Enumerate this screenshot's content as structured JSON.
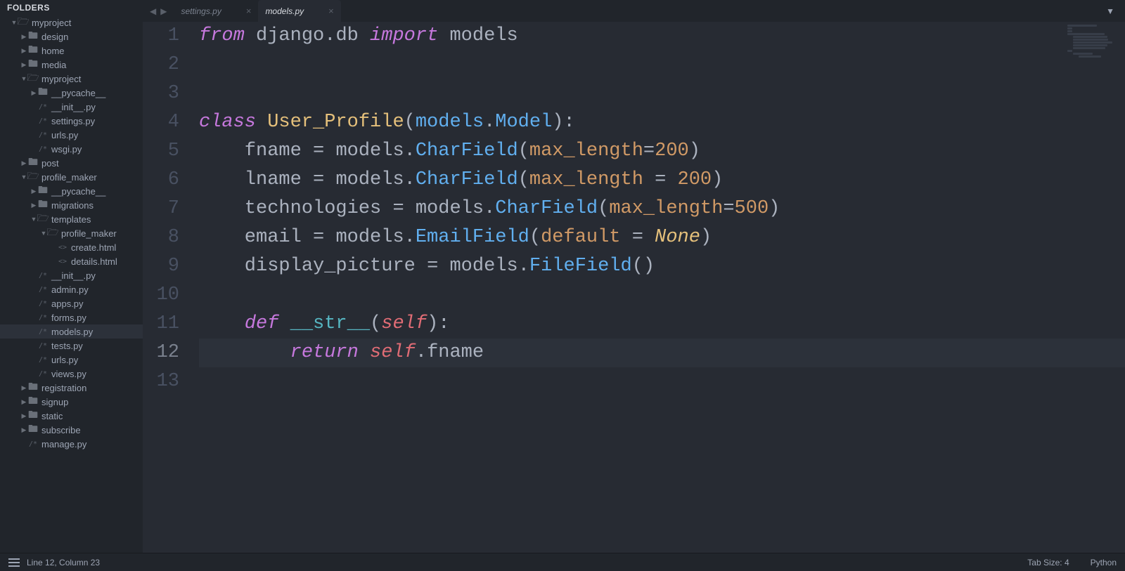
{
  "sidebar": {
    "header": "FOLDERS",
    "tree": [
      {
        "depth": 0,
        "arrow": "▼",
        "icon": "folder-open",
        "label": "myproject"
      },
      {
        "depth": 1,
        "arrow": "▶",
        "icon": "folder",
        "label": "design"
      },
      {
        "depth": 1,
        "arrow": "▶",
        "icon": "folder",
        "label": "home"
      },
      {
        "depth": 1,
        "arrow": "▶",
        "icon": "folder",
        "label": "media"
      },
      {
        "depth": 1,
        "arrow": "▼",
        "icon": "folder-open",
        "label": "myproject"
      },
      {
        "depth": 2,
        "arrow": "▶",
        "icon": "folder",
        "label": "__pycache__"
      },
      {
        "depth": 2,
        "arrow": "",
        "icon": "py",
        "label": "__init__.py"
      },
      {
        "depth": 2,
        "arrow": "",
        "icon": "py",
        "label": "settings.py"
      },
      {
        "depth": 2,
        "arrow": "",
        "icon": "py",
        "label": "urls.py"
      },
      {
        "depth": 2,
        "arrow": "",
        "icon": "py",
        "label": "wsgi.py"
      },
      {
        "depth": 1,
        "arrow": "▶",
        "icon": "folder",
        "label": "post"
      },
      {
        "depth": 1,
        "arrow": "▼",
        "icon": "folder-open",
        "label": "profile_maker"
      },
      {
        "depth": 2,
        "arrow": "▶",
        "icon": "folder",
        "label": "__pycache__"
      },
      {
        "depth": 2,
        "arrow": "▶",
        "icon": "folder",
        "label": "migrations"
      },
      {
        "depth": 2,
        "arrow": "▼",
        "icon": "folder-open",
        "label": "templates"
      },
      {
        "depth": 3,
        "arrow": "▼",
        "icon": "folder-open",
        "label": "profile_maker"
      },
      {
        "depth": 4,
        "arrow": "",
        "icon": "html",
        "label": "create.html"
      },
      {
        "depth": 4,
        "arrow": "",
        "icon": "html",
        "label": "details.html"
      },
      {
        "depth": 2,
        "arrow": "",
        "icon": "py",
        "label": "__init__.py"
      },
      {
        "depth": 2,
        "arrow": "",
        "icon": "py",
        "label": "admin.py"
      },
      {
        "depth": 2,
        "arrow": "",
        "icon": "py",
        "label": "apps.py"
      },
      {
        "depth": 2,
        "arrow": "",
        "icon": "py",
        "label": "forms.py"
      },
      {
        "depth": 2,
        "arrow": "",
        "icon": "py",
        "label": "models.py",
        "selected": true
      },
      {
        "depth": 2,
        "arrow": "",
        "icon": "py",
        "label": "tests.py"
      },
      {
        "depth": 2,
        "arrow": "",
        "icon": "py",
        "label": "urls.py"
      },
      {
        "depth": 2,
        "arrow": "",
        "icon": "py",
        "label": "views.py"
      },
      {
        "depth": 1,
        "arrow": "▶",
        "icon": "folder",
        "label": "registration"
      },
      {
        "depth": 1,
        "arrow": "▶",
        "icon": "folder",
        "label": "signup"
      },
      {
        "depth": 1,
        "arrow": "▶",
        "icon": "folder",
        "label": "static"
      },
      {
        "depth": 1,
        "arrow": "▶",
        "icon": "folder",
        "label": "subscribe"
      },
      {
        "depth": 1,
        "arrow": "",
        "icon": "py",
        "label": "manage.py"
      }
    ]
  },
  "tabs": [
    {
      "label": "settings.py",
      "active": false
    },
    {
      "label": "models.py",
      "active": true
    }
  ],
  "code": {
    "active_line": 12,
    "lines": [
      [
        {
          "c": "kw-from",
          "t": "from"
        },
        {
          "c": "pale",
          "t": " django"
        },
        {
          "c": "punct",
          "t": "."
        },
        {
          "c": "pale",
          "t": "db "
        },
        {
          "c": "kw-import",
          "t": "import"
        },
        {
          "c": "pale",
          "t": " models"
        }
      ],
      [],
      [],
      [
        {
          "c": "kw-class",
          "t": "class"
        },
        {
          "c": "pale",
          "t": " "
        },
        {
          "c": "fn",
          "t": "User_Profile"
        },
        {
          "c": "punct",
          "t": "("
        },
        {
          "c": "cls",
          "t": "models"
        },
        {
          "c": "punct",
          "t": "."
        },
        {
          "c": "cls",
          "t": "Model"
        },
        {
          "c": "punct",
          "t": "):"
        }
      ],
      [
        {
          "c": "pale",
          "t": "    fname "
        },
        {
          "c": "punct",
          "t": "= "
        },
        {
          "c": "pale",
          "t": "models"
        },
        {
          "c": "punct",
          "t": "."
        },
        {
          "c": "cls",
          "t": "CharField"
        },
        {
          "c": "punct",
          "t": "("
        },
        {
          "c": "param",
          "t": "max_length"
        },
        {
          "c": "punct",
          "t": "="
        },
        {
          "c": "num",
          "t": "200"
        },
        {
          "c": "punct",
          "t": ")"
        }
      ],
      [
        {
          "c": "pale",
          "t": "    lname "
        },
        {
          "c": "punct",
          "t": "= "
        },
        {
          "c": "pale",
          "t": "models"
        },
        {
          "c": "punct",
          "t": "."
        },
        {
          "c": "cls",
          "t": "CharField"
        },
        {
          "c": "punct",
          "t": "("
        },
        {
          "c": "param",
          "t": "max_length"
        },
        {
          "c": "punct",
          "t": " = "
        },
        {
          "c": "num",
          "t": "200"
        },
        {
          "c": "punct",
          "t": ")"
        }
      ],
      [
        {
          "c": "pale",
          "t": "    technologies "
        },
        {
          "c": "punct",
          "t": "= "
        },
        {
          "c": "pale",
          "t": "models"
        },
        {
          "c": "punct",
          "t": "."
        },
        {
          "c": "cls",
          "t": "CharField"
        },
        {
          "c": "punct",
          "t": "("
        },
        {
          "c": "param",
          "t": "max_length"
        },
        {
          "c": "punct",
          "t": "="
        },
        {
          "c": "num",
          "t": "500"
        },
        {
          "c": "punct",
          "t": ")"
        }
      ],
      [
        {
          "c": "pale",
          "t": "    email "
        },
        {
          "c": "punct",
          "t": "= "
        },
        {
          "c": "pale",
          "t": "models"
        },
        {
          "c": "punct",
          "t": "."
        },
        {
          "c": "cls",
          "t": "EmailField"
        },
        {
          "c": "punct",
          "t": "("
        },
        {
          "c": "param",
          "t": "default"
        },
        {
          "c": "punct",
          "t": " = "
        },
        {
          "c": "none",
          "t": "None"
        },
        {
          "c": "punct",
          "t": ")"
        }
      ],
      [
        {
          "c": "pale",
          "t": "    display_picture "
        },
        {
          "c": "punct",
          "t": "= "
        },
        {
          "c": "pale",
          "t": "models"
        },
        {
          "c": "punct",
          "t": "."
        },
        {
          "c": "cls",
          "t": "FileField"
        },
        {
          "c": "punct",
          "t": "()"
        }
      ],
      [],
      [
        {
          "c": "pale",
          "t": "    "
        },
        {
          "c": "kw-def",
          "t": "def"
        },
        {
          "c": "pale",
          "t": " "
        },
        {
          "c": "dunder",
          "t": "__str__"
        },
        {
          "c": "punct",
          "t": "("
        },
        {
          "c": "self",
          "t": "self"
        },
        {
          "c": "punct",
          "t": "):"
        }
      ],
      [
        {
          "c": "pale",
          "t": "        "
        },
        {
          "c": "kw-return",
          "t": "return"
        },
        {
          "c": "pale",
          "t": " "
        },
        {
          "c": "self",
          "t": "self"
        },
        {
          "c": "punct",
          "t": "."
        },
        {
          "c": "pale",
          "t": "fname"
        }
      ],
      []
    ]
  },
  "status": {
    "position": "Line 12, Column 23",
    "tab_size": "Tab Size: 4",
    "language": "Python"
  }
}
